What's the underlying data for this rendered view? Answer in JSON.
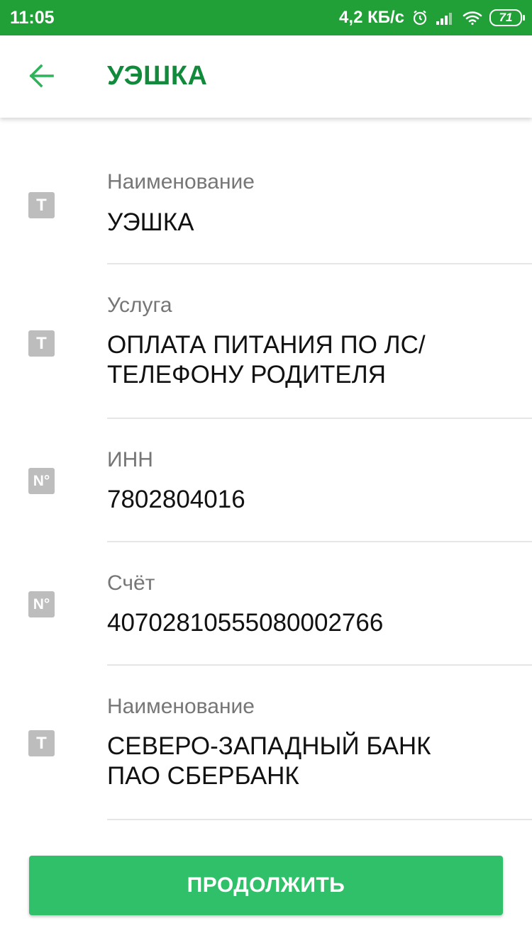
{
  "status_bar": {
    "time": "11:05",
    "network_speed": "4,2 КБ/с",
    "battery_level": "71",
    "icons": [
      "alarm-icon",
      "signal-icon",
      "wifi-icon",
      "battery-icon"
    ]
  },
  "toolbar": {
    "title": "УЭШКА",
    "back_icon": "arrow-left-icon"
  },
  "fields": [
    {
      "icon_text": "T",
      "label": "Наименование",
      "value": "УЭШКА"
    },
    {
      "icon_text": "T",
      "label": "Услуга",
      "value": "ОПЛАТА ПИТАНИЯ ПО ЛС/ ТЕЛЕФОНУ РОДИТЕЛЯ"
    },
    {
      "icon_text": "N°",
      "label": "ИНН",
      "value": "7802804016"
    },
    {
      "icon_text": "N°",
      "label": "Счёт",
      "value": "40702810555080002766"
    },
    {
      "icon_text": "T",
      "label": "Наименование",
      "value": "СЕВЕРО-ЗАПАДНЫЙ БАНК ПАО СБЕРБАНК"
    }
  ],
  "continue_button": {
    "label": "ПРОДОЛЖИТЬ"
  },
  "colors": {
    "status_bar": "#21a038",
    "title": "#128a3b",
    "accent": "#2fb35a",
    "button": "#30c06a",
    "icon_badge": "#bdbdbd"
  }
}
